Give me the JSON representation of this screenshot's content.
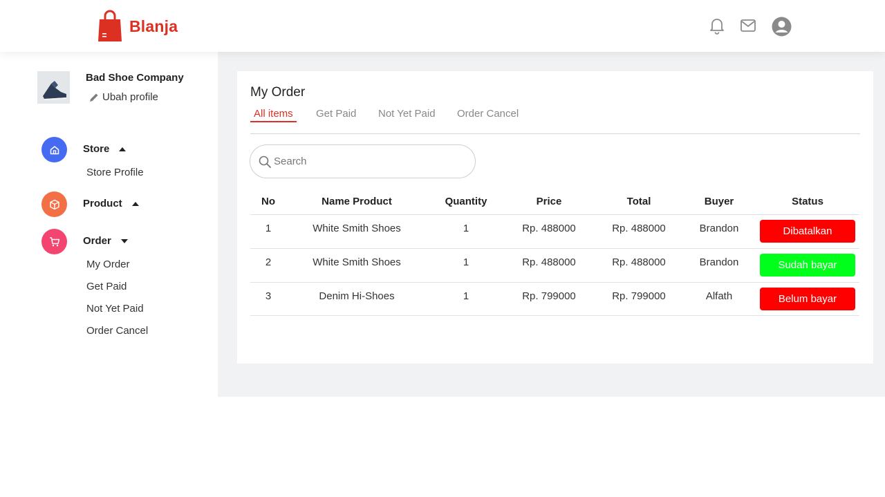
{
  "app": {
    "name": "Blanja",
    "brand_color": "#DB3022"
  },
  "header": {
    "icons": [
      "bell-icon",
      "mail-icon",
      "user-avatar-icon"
    ]
  },
  "profile": {
    "store_name": "Bad Shoe Company",
    "edit_label": "Ubah profile"
  },
  "sidebar": {
    "store": {
      "label": "Store",
      "color": "#456BF3",
      "items": [
        "Store Profile"
      ]
    },
    "product": {
      "label": "Product",
      "color": "#F36F45"
    },
    "order": {
      "label": "Order",
      "color": "#F3456F",
      "items": [
        "My Order",
        "Get Paid",
        "Not Yet Paid",
        "Order Cancel"
      ]
    }
  },
  "main": {
    "title": "My Order",
    "tabs": [
      "All items",
      "Get Paid",
      "Not Yet Paid",
      "Order Cancel"
    ],
    "active_tab": "All items",
    "search": {
      "placeholder": "Search",
      "value": ""
    },
    "table": {
      "headers": [
        "No",
        "Name Product",
        "Quantity",
        "Price",
        "Total",
        "Buyer",
        "Status"
      ],
      "rows": [
        {
          "no": "1",
          "product": "White Smith Shoes",
          "quantity": "1",
          "price": "Rp. 488000",
          "total": "Rp. 488000",
          "buyer": "Brandon",
          "status": "Dibatalkan",
          "status_color": "#FF0000"
        },
        {
          "no": "2",
          "product": "White Smith Shoes",
          "quantity": "1",
          "price": "Rp. 488000",
          "total": "Rp. 488000",
          "buyer": "Brandon",
          "status": "Sudah bayar",
          "status_color": "#00FF1A"
        },
        {
          "no": "3",
          "product": "Denim Hi-Shoes",
          "quantity": "1",
          "price": "Rp. 799000",
          "total": "Rp. 799000",
          "buyer": "Alfath",
          "status": "Belum bayar",
          "status_color": "#FF0000"
        }
      ]
    }
  }
}
